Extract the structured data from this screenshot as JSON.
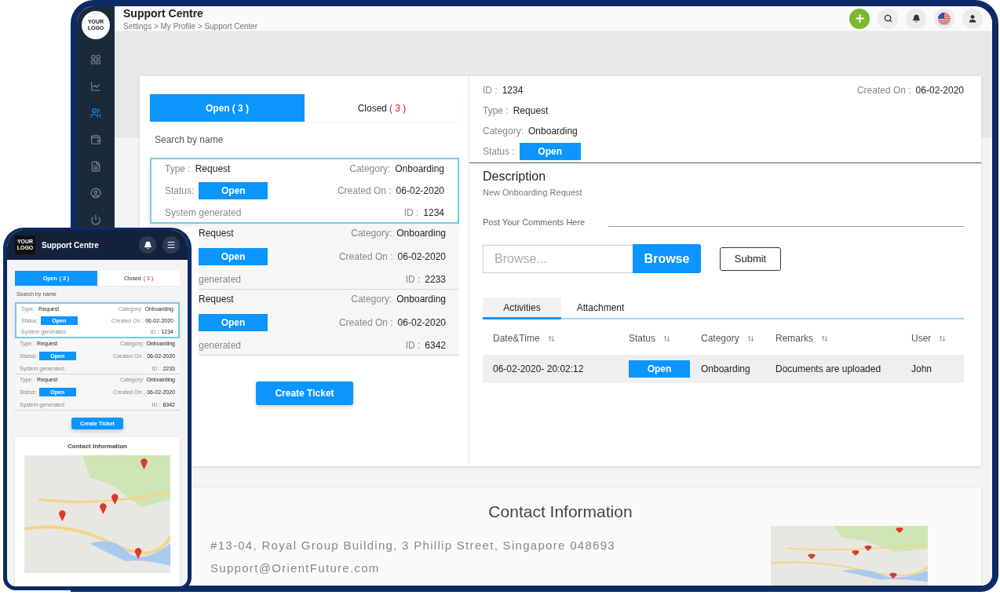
{
  "desktop": {
    "logo": "YOUR LOGO",
    "sidebar": {
      "items": [
        {
          "selected": false
        },
        {
          "selected": false
        },
        {
          "selected": true
        },
        {
          "selected": false
        },
        {
          "selected": false
        },
        {
          "selected": false
        },
        {
          "selected": false
        }
      ]
    },
    "header": {
      "title": "Support Centre",
      "breadcrumb": "Settings > My Profile > Support Center"
    },
    "tabs": [
      {
        "label": "Open",
        "count": "( 3 )",
        "selected": true
      },
      {
        "label": "Closed",
        "count": "( 3 )",
        "selected": false
      }
    ],
    "search": {
      "placeholder": "Search by name"
    },
    "tickets": [
      {
        "selected": true,
        "type_label": "Type :",
        "type": "Request",
        "category_label": "Category:",
        "category": "Onboarding",
        "status_label": "Status:",
        "status": "Open",
        "created_label": "Created On :",
        "created": "06-02-2020",
        "id_label": "ID :",
        "id": "1234",
        "source": "System generated"
      },
      {
        "selected": false,
        "type": "Request",
        "category_label": "Category:",
        "category": "Onboarding",
        "status": "Open",
        "created_label": "Created On :",
        "created": "06-02-2020",
        "id_label": "ID :",
        "id": "2233",
        "source": "generated"
      },
      {
        "selected": false,
        "type": "Request",
        "category_label": "Category:",
        "category": "Onboarding",
        "status": "Open",
        "created_label": "Created On :",
        "created": "06-02-2020",
        "id_label": "ID :",
        "id": "6342",
        "source": "generated"
      }
    ],
    "create_button": "Create Ticket",
    "detail": {
      "id_label": "ID :",
      "id": "1234",
      "type_label": "Type :",
      "type": "Request",
      "category_label": "Category:",
      "category": "Onboarding",
      "status_label": "Status :",
      "status": "Open",
      "created_label": "Created On :",
      "created": "06-02-2020",
      "description_title": "Description",
      "description": "New Onboarding Request",
      "comments_label": "Post Your Comments Here",
      "browse_placeholder": "Browse...",
      "browse_button": "Browse",
      "submit_button": "Submit",
      "tabs": [
        {
          "label": "Activities",
          "selected": true
        },
        {
          "label": "Attachment",
          "selected": false
        }
      ],
      "table": {
        "columns": [
          "Date&Time",
          "Status",
          "Category",
          "Remarks",
          "User"
        ],
        "rows": [
          {
            "datetime": "06-02-2020- 20:02:12",
            "status": "Open",
            "category": "Onboarding",
            "remarks": "Documents are uploaded",
            "user": "John"
          }
        ]
      }
    },
    "contact": {
      "title": "Contact Information",
      "address": "#13-04, Royal Group Building, 3 Phillip Street, Singapore 048693",
      "email": "Support@OrientFuture.com"
    }
  },
  "mobile": {
    "logo": "YOUR LOGO",
    "title": "Support Centre",
    "tabs": [
      {
        "label": "Open",
        "count": "( 3 )",
        "selected": true
      },
      {
        "label": "Closed",
        "count": "( 3 )",
        "selected": false
      }
    ],
    "search": {
      "placeholder": "Search by name"
    },
    "tickets": [
      {
        "selected": true,
        "type_label": "Type :",
        "type": "Request",
        "category_label": "Category:",
        "category": "Onboarding",
        "status_label": "Status:",
        "status": "Open",
        "created_label": "Created On :",
        "created": "06-02-2020",
        "id_label": "ID :",
        "id": "1234",
        "source": "System generated"
      },
      {
        "selected": false,
        "type_label": "Type :",
        "type": "Request",
        "category_label": "Category:",
        "category": "Onboarding",
        "status_label": "Status:",
        "status": "Open",
        "created_label": "Created On :",
        "created": "06-02-2020",
        "id_label": "ID :",
        "id": "2233",
        "source": "System generated"
      },
      {
        "selected": false,
        "type_label": "Type :",
        "type": "Request",
        "category_label": "Category:",
        "category": "Onboarding",
        "status_label": "Status:",
        "status": "Open",
        "created_label": "Created On :",
        "created": "06-02-2020",
        "id_label": "ID :",
        "id": "6342",
        "source": "System generated"
      }
    ],
    "create_button": "Create Ticket",
    "contact_title": "Contact Information"
  }
}
